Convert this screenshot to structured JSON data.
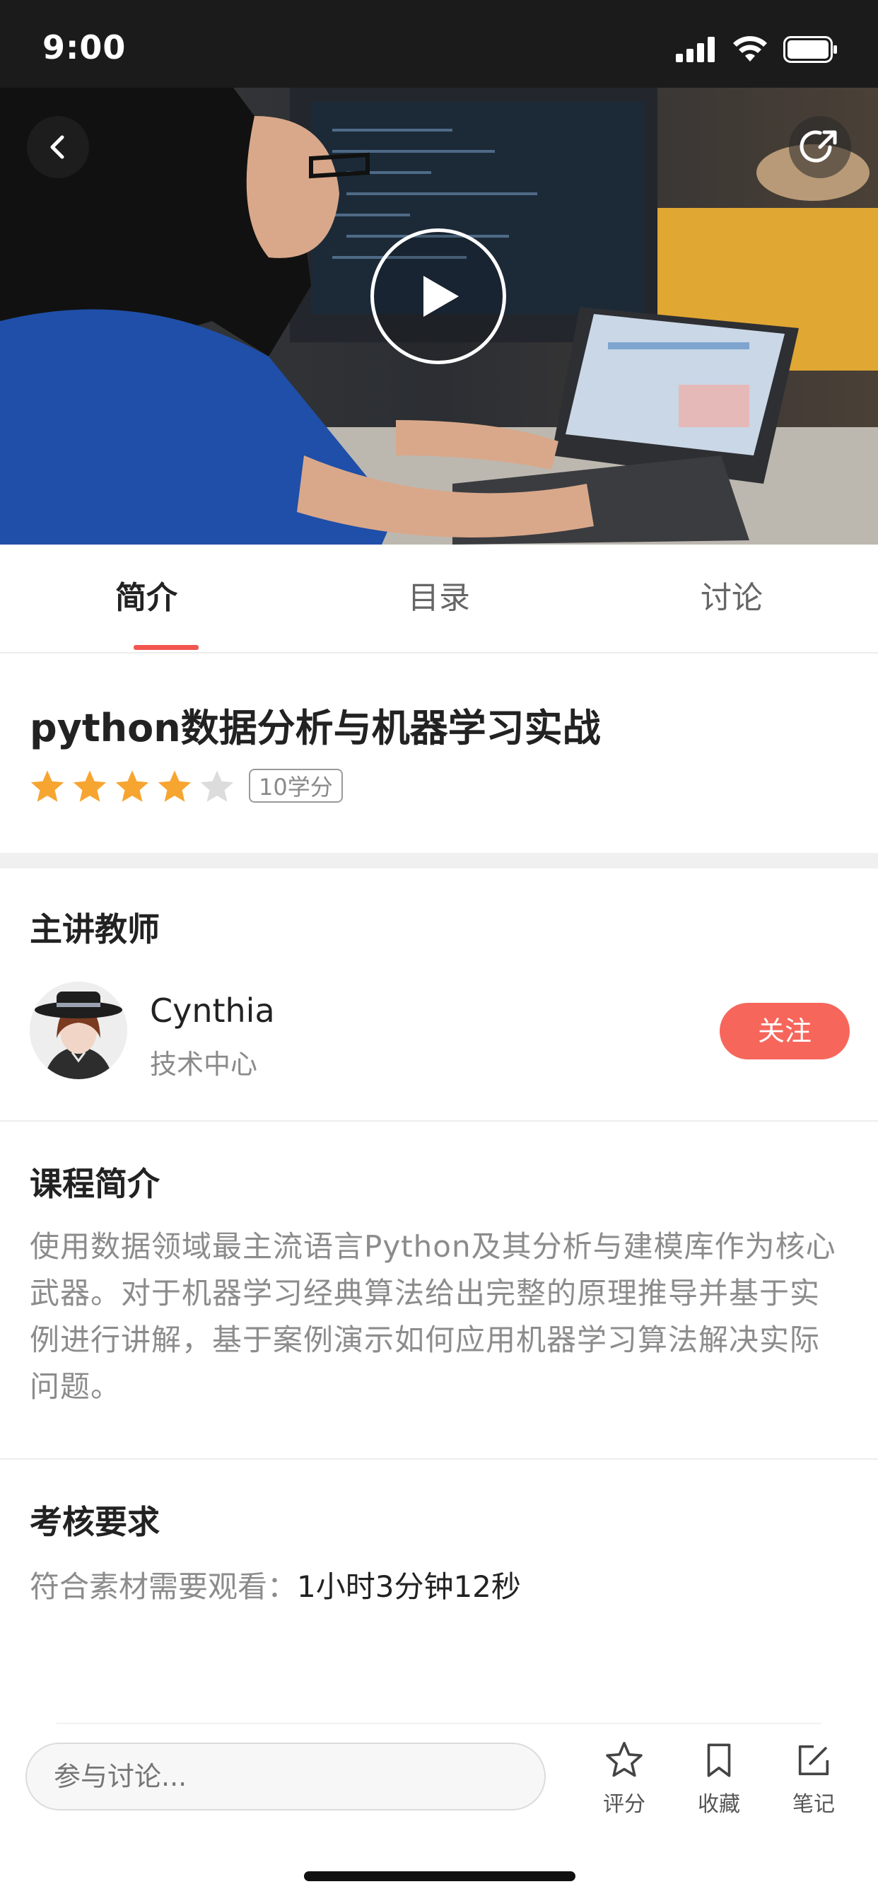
{
  "status_bar": {
    "time": "9:00"
  },
  "video": {
    "has_play_button": true
  },
  "tabs": [
    {
      "label": "简介",
      "active": true
    },
    {
      "label": "目录",
      "active": false
    },
    {
      "label": "讨论",
      "active": false
    }
  ],
  "course": {
    "title": "python数据分析与机器学习实战",
    "rating": 4,
    "rating_max": 5,
    "credit": "10学分"
  },
  "teacher_section": {
    "heading": "主讲教师",
    "name": "Cynthia",
    "department": "技术中心",
    "follow_label": "关注"
  },
  "intro_section": {
    "heading": "课程简介",
    "text": "使用数据领域最主流语言Python及其分析与建模库作为核心武器。对于机器学习经典算法给出完整的原理推导并基于实例进行讲解，基于案例演示如何应用机器学习算法解决实际问题。"
  },
  "requirement_section": {
    "heading": "考核要求",
    "label": "符合素材需要观看：",
    "value": "1小时3分钟12秒"
  },
  "bottom_bar": {
    "input_placeholder": "参与讨论...",
    "actions": [
      {
        "label": "评分",
        "icon": "star-outline-icon"
      },
      {
        "label": "收藏",
        "icon": "bookmark-icon"
      },
      {
        "label": "笔记",
        "icon": "edit-note-icon"
      }
    ]
  },
  "colors": {
    "accent": "#f2564f",
    "follow_button": "#f7665b",
    "star_filled": "#f7a531",
    "star_empty": "#dcdcdc"
  }
}
